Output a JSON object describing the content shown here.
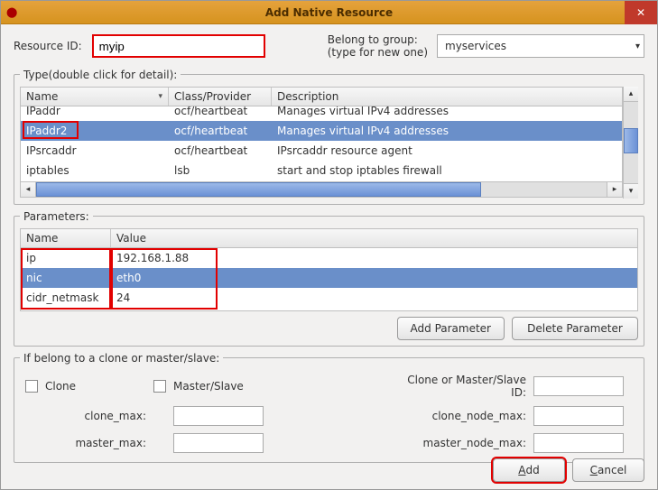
{
  "window": {
    "title": "Add Native Resource"
  },
  "resource_id": {
    "label": "Resource ID:",
    "value": "myip"
  },
  "group": {
    "label_line1": "Belong to group:",
    "label_line2": "(type for new one)",
    "value": "myservices"
  },
  "type": {
    "legend": "Type(double click for detail):",
    "columns": {
      "name": "Name",
      "class": "Class/Provider",
      "desc": "Description"
    },
    "rows": [
      {
        "name": "IPaddr",
        "cls": "ocf/heartbeat",
        "desc": "Manages virtual IPv4 addresses",
        "selected": false,
        "highlighted": false
      },
      {
        "name": "IPaddr2",
        "cls": "ocf/heartbeat",
        "desc": "Manages virtual IPv4 addresses",
        "selected": true,
        "highlighted": true
      },
      {
        "name": "IPsrcaddr",
        "cls": "ocf/heartbeat",
        "desc": "IPsrcaddr resource agent",
        "selected": false,
        "highlighted": false
      },
      {
        "name": "iptables",
        "cls": "lsb",
        "desc": " start and stop iptables firewall",
        "selected": false,
        "highlighted": false
      }
    ]
  },
  "parameters": {
    "legend": "Parameters:",
    "columns": {
      "name": "Name",
      "value": "Value"
    },
    "rows": [
      {
        "name": "ip",
        "value": "192.168.1.88",
        "selected": false
      },
      {
        "name": "nic",
        "value": "eth0",
        "selected": true
      },
      {
        "name": "cidr_netmask",
        "value": "24",
        "selected": false
      }
    ],
    "btn_add": "Add Parameter",
    "btn_del": "Delete Parameter"
  },
  "clone": {
    "legend": "If belong to a clone or master/slave:",
    "clone_label": "Clone",
    "ms_label": "Master/Slave",
    "id_label": "Clone or Master/Slave ID:",
    "clone_max": "clone_max:",
    "clone_node_max": "clone_node_max:",
    "master_max": "master_max:",
    "master_node_max": "master_node_max:"
  },
  "footer": {
    "add_u": "A",
    "add_rest": "dd",
    "cancel_u": "C",
    "cancel_rest": "ancel"
  }
}
